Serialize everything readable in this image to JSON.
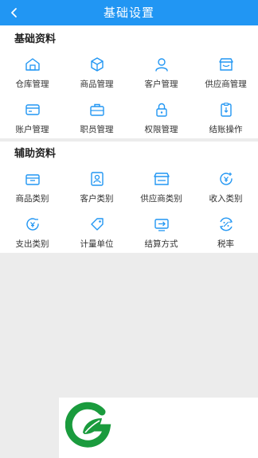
{
  "header": {
    "title": "基础设置",
    "back_icon": "chevron-left-icon"
  },
  "colors": {
    "brand": "#2196f3",
    "icon": "#2196f3",
    "logo_green": "#1a9b3d"
  },
  "sections": [
    {
      "title": "基础资料",
      "items": [
        {
          "label": "仓库管理",
          "icon": "warehouse-icon"
        },
        {
          "label": "商品管理",
          "icon": "box-icon"
        },
        {
          "label": "客户管理",
          "icon": "user-icon"
        },
        {
          "label": "供应商管理",
          "icon": "store-icon"
        },
        {
          "label": "账户管理",
          "icon": "card-icon"
        },
        {
          "label": "职员管理",
          "icon": "briefcase-icon"
        },
        {
          "label": "权限管理",
          "icon": "lock-icon"
        },
        {
          "label": "结账操作",
          "icon": "clipboard-icon"
        }
      ]
    },
    {
      "title": "辅助资料",
      "items": [
        {
          "label": "商品类别",
          "icon": "package-icon"
        },
        {
          "label": "客户类别",
          "icon": "contact-card-icon"
        },
        {
          "label": "供应商类别",
          "icon": "shop-icon"
        },
        {
          "label": "收入类别",
          "icon": "income-icon"
        },
        {
          "label": "支出类别",
          "icon": "expense-icon"
        },
        {
          "label": "计量单位",
          "icon": "tag-icon"
        },
        {
          "label": "结算方式",
          "icon": "transfer-icon"
        },
        {
          "label": "税率",
          "icon": "tax-icon"
        }
      ]
    }
  ]
}
